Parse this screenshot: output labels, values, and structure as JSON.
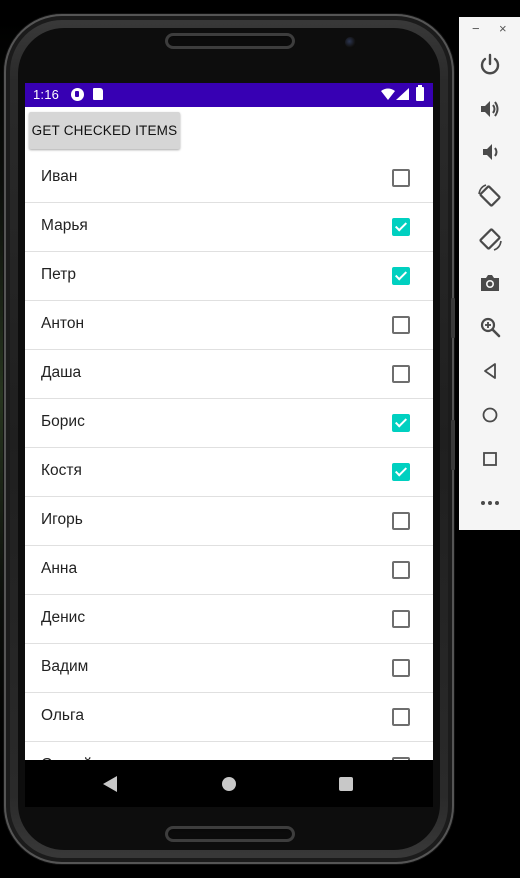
{
  "status_bar": {
    "time": "1:16",
    "background": "#3700b3"
  },
  "app": {
    "button_label": "GET CHECKED ITEMS",
    "items": [
      {
        "label": "Иван",
        "checked": false
      },
      {
        "label": "Марья",
        "checked": true
      },
      {
        "label": "Петр",
        "checked": true
      },
      {
        "label": "Антон",
        "checked": false
      },
      {
        "label": "Даша",
        "checked": false
      },
      {
        "label": "Борис",
        "checked": true
      },
      {
        "label": "Костя",
        "checked": true
      },
      {
        "label": "Игорь",
        "checked": false
      },
      {
        "label": "Анна",
        "checked": false
      },
      {
        "label": "Денис",
        "checked": false
      },
      {
        "label": "Вадим",
        "checked": false
      },
      {
        "label": "Ольга",
        "checked": false
      },
      {
        "label": "Сергей",
        "checked": false
      }
    ],
    "checkbox_color": "#00d0c0"
  },
  "emulator_toolbar": {
    "minimize_label": "−",
    "close_label": "×",
    "buttons": [
      {
        "icon": "power-icon"
      },
      {
        "icon": "volume-up-icon"
      },
      {
        "icon": "volume-down-icon"
      },
      {
        "icon": "rotate-left-icon"
      },
      {
        "icon": "rotate-right-icon"
      },
      {
        "icon": "camera-icon"
      },
      {
        "icon": "zoom-icon"
      },
      {
        "icon": "back-icon"
      },
      {
        "icon": "home-icon"
      },
      {
        "icon": "overview-icon"
      },
      {
        "icon": "more-icon"
      }
    ]
  }
}
